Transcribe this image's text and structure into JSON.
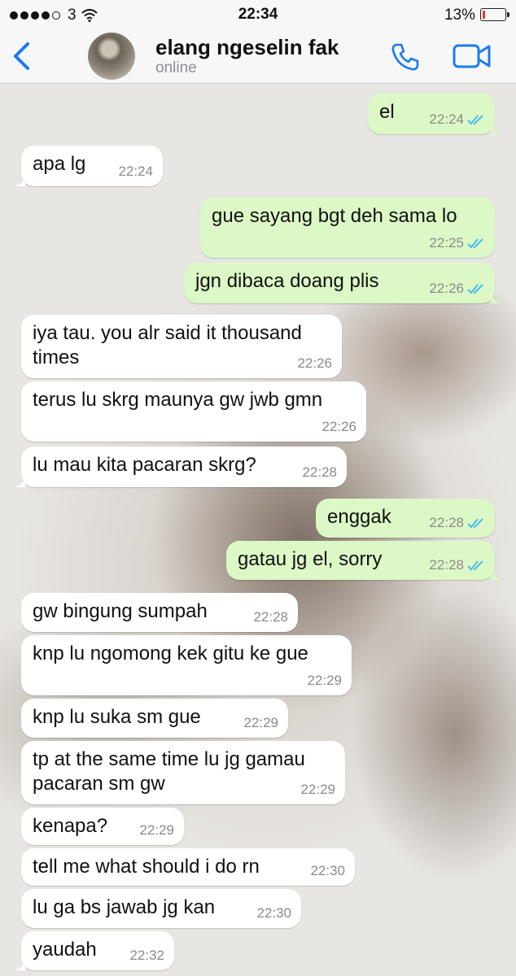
{
  "status_bar": {
    "carrier": "3",
    "time": "22:34",
    "battery": "13%",
    "battery_level": 0.13
  },
  "header": {
    "back_icon": "chevron-left-icon",
    "contact_name": "elang ngeselin fak",
    "contact_status": "online",
    "call_icon": "phone-icon",
    "video_icon": "video-camera-icon"
  },
  "colors": {
    "accent": "#1b7cf0",
    "outgoing": "#dcf8c6",
    "incoming": "#ffffff",
    "read_tick": "#34b7f1"
  },
  "messages": [
    {
      "dir": "out",
      "text": "el",
      "time": "22:24",
      "read": true
    },
    {
      "dir": "in",
      "text": "apa lg",
      "time": "22:24"
    },
    {
      "dir": "out",
      "text": "gue sayang bgt deh sama lo",
      "time": "22:25",
      "read": true
    },
    {
      "dir": "out",
      "text": "jgn dibaca doang plis",
      "time": "22:26",
      "read": true
    },
    {
      "dir": "in",
      "text": "iya tau. you alr said it thousand\ntimes",
      "time": "22:26"
    },
    {
      "dir": "in",
      "text": "terus lu skrg maunya gw jwb gmn",
      "time": "22:26"
    },
    {
      "dir": "in",
      "text": "lu mau kita pacaran skrg?",
      "time": "22:28"
    },
    {
      "dir": "out",
      "text": "enggak",
      "time": "22:28",
      "read": true
    },
    {
      "dir": "out",
      "text": "gatau jg el, sorry",
      "time": "22:28",
      "read": true
    },
    {
      "dir": "in",
      "text": "gw bingung sumpah",
      "time": "22:28"
    },
    {
      "dir": "in",
      "text": "knp lu ngomong kek gitu ke gue",
      "time": "22:29"
    },
    {
      "dir": "in",
      "text": "knp lu suka sm gue",
      "time": "22:29"
    },
    {
      "dir": "in",
      "text": "tp at the same time lu jg gamau\npacaran sm gw",
      "time": "22:29"
    },
    {
      "dir": "in",
      "text": "kenapa?",
      "time": "22:29"
    },
    {
      "dir": "in",
      "text": "tell me what should i do rn",
      "time": "22:30"
    },
    {
      "dir": "in",
      "text": "lu ga bs jawab jg kan",
      "time": "22:30"
    },
    {
      "dir": "in",
      "text": "yaudah",
      "time": "22:32"
    }
  ]
}
